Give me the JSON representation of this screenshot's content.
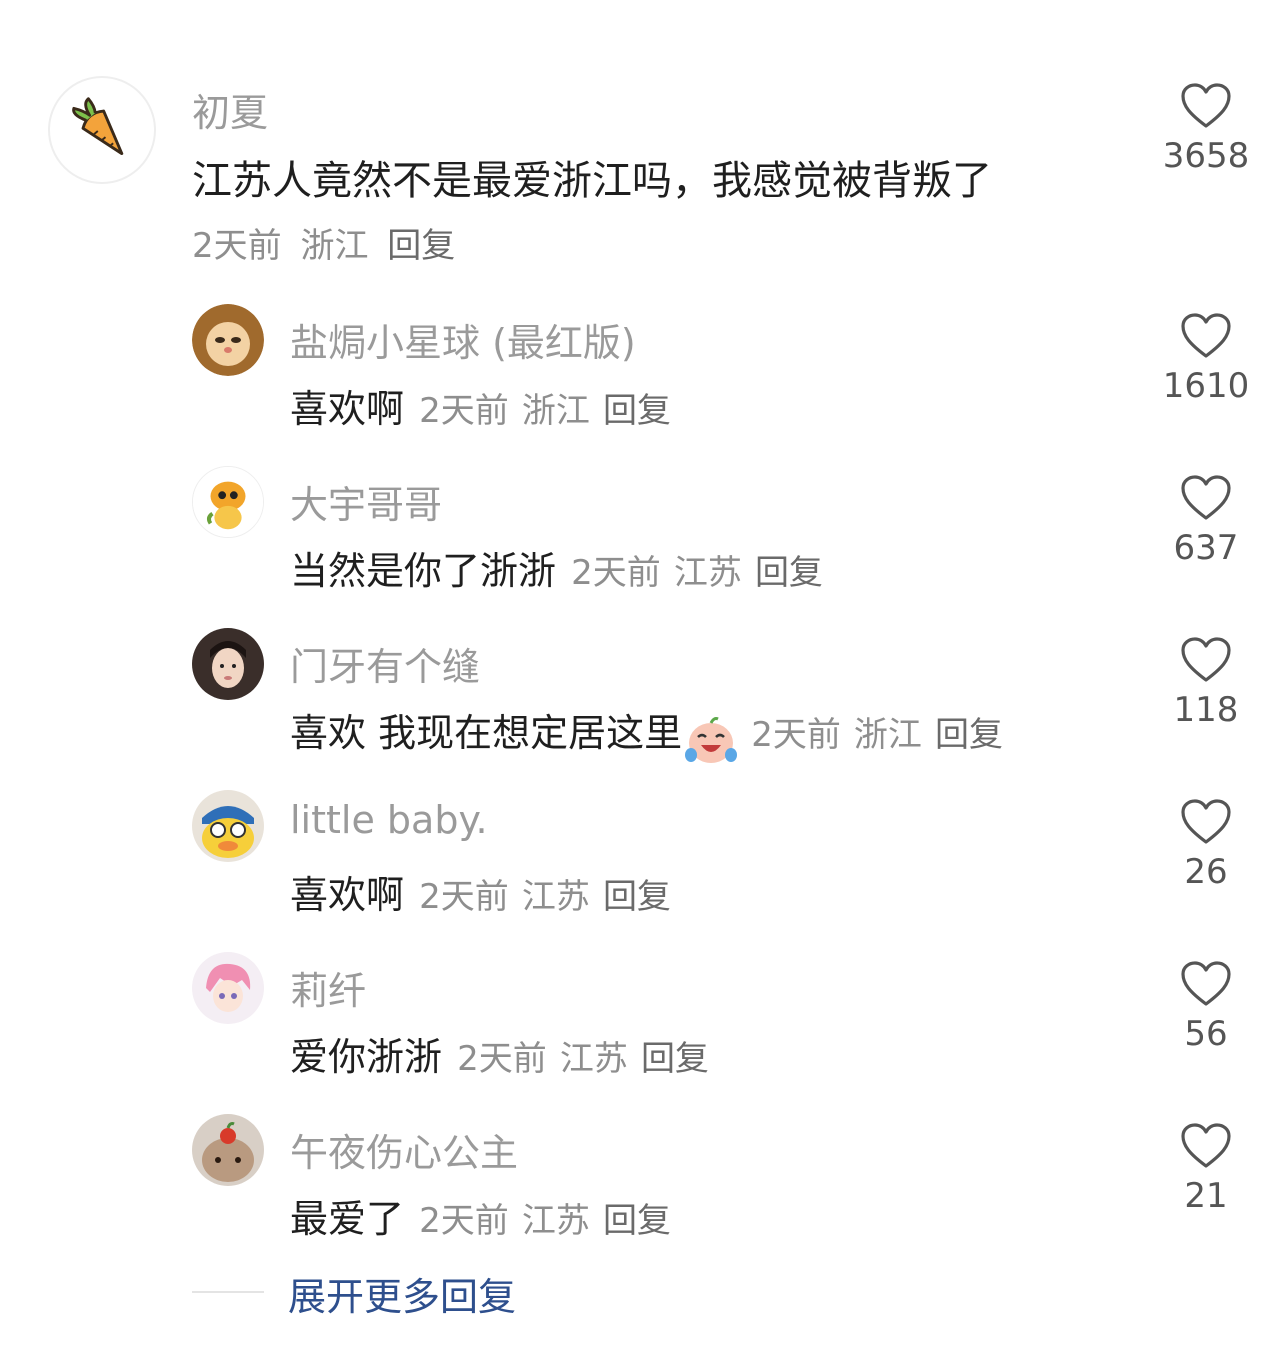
{
  "main_comment": {
    "username": "初夏",
    "avatar_icon": "carrot-icon",
    "text": "江苏人竟然不是最爱浙江吗，我感觉被背叛了",
    "time": "2天前",
    "location": "浙江",
    "reply_label": "回复",
    "likes": "3658"
  },
  "replies": [
    {
      "username": "盐焗小星球 (最红版)",
      "avatar_icon": "lion-cat-avatar",
      "text": "喜欢啊",
      "time": "2天前",
      "location": "浙江",
      "reply_label": "回复",
      "likes": "1610"
    },
    {
      "username": "大宇哥哥",
      "avatar_icon": "cartoon-bird-avatar",
      "text": "当然是你了浙浙",
      "time": "2天前",
      "location": "江苏",
      "reply_label": "回复",
      "likes": "637"
    },
    {
      "username": "门牙有个缝",
      "avatar_icon": "girl-photo-avatar",
      "text": "喜欢 我现在想定居这里",
      "emoji": "crying-laughing-emoji",
      "time": "2天前",
      "location": "浙江",
      "reply_label": "回复",
      "likes": "118"
    },
    {
      "username": "little baby.",
      "avatar_icon": "duck-avatar",
      "text": "喜欢啊",
      "time": "2天前",
      "location": "江苏",
      "reply_label": "回复",
      "likes": "26"
    },
    {
      "username": "莉纤",
      "avatar_icon": "anime-boy-avatar",
      "text": "爱你浙浙",
      "time": "2天前",
      "location": "江苏",
      "reply_label": "回复",
      "likes": "56"
    },
    {
      "username": "午夜伤心公主",
      "avatar_icon": "rabbit-avatar",
      "text": "最爱了",
      "time": "2天前",
      "location": "江苏",
      "reply_label": "回复",
      "likes": "21"
    }
  ],
  "expand_more": {
    "label": "展开更多回复"
  },
  "colors": {
    "username": "#9a9a9a",
    "meta": "#8e8e8e",
    "link": "#2e4f8d",
    "heart_outline": "#555555"
  }
}
